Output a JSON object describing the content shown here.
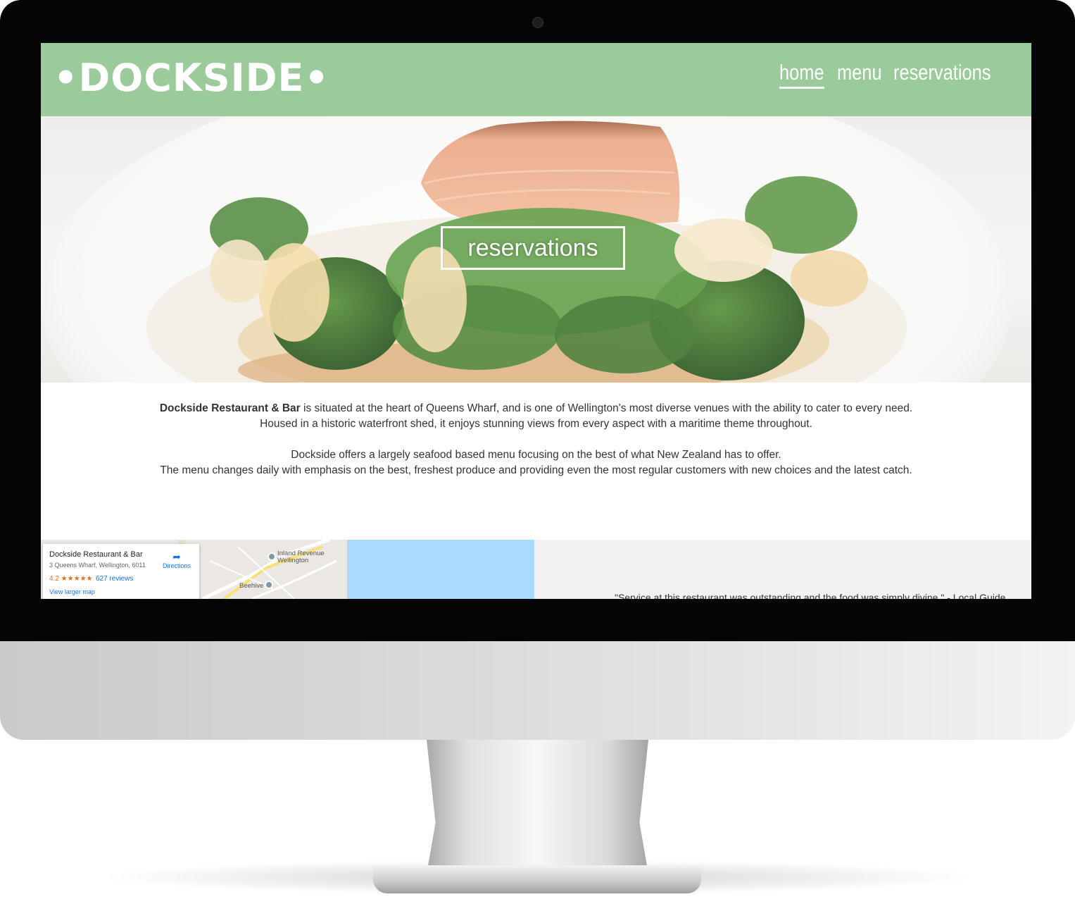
{
  "site": {
    "logo": "•DOCKSIDE•",
    "nav": [
      {
        "label": "home",
        "active": true
      },
      {
        "label": "menu",
        "active": false
      },
      {
        "label": "reservations",
        "active": false
      }
    ],
    "header_color": "#9bcb9a"
  },
  "hero": {
    "cta_label": "reservations"
  },
  "intro": {
    "p1_bold": "Dockside Restaurant & Bar",
    "p1_rest": " is situated at the heart of Queens Wharf, and is one of Wellington's most diverse venues with the ability to cater to every need.",
    "p1_line2": "Housed in a historic waterfront shed, it enjoys stunning views from every aspect with a maritime theme throughout.",
    "p2_line1": "Dockside offers a largely seafood based menu focusing on the best of what New Zealand has to offer.",
    "p2_line2": "The menu changes daily with emphasis on the best, freshest produce and providing even the most regular customers with new choices and the latest catch."
  },
  "map": {
    "title": "Dockside Restaurant & Bar",
    "address": "3 Queens Wharf, Wellington, 6011",
    "rating": "4.2 ★★★★★",
    "reviews": "627 reviews",
    "larger_map": "View larger map",
    "directions": "Directions",
    "place_1": "Inland Revenue",
    "place_1b": "Wellington",
    "place_2": "Beehive"
  },
  "testimonial": "\"Service at this restaurant was outstanding and the food was simply divine.\" - Local Guide"
}
